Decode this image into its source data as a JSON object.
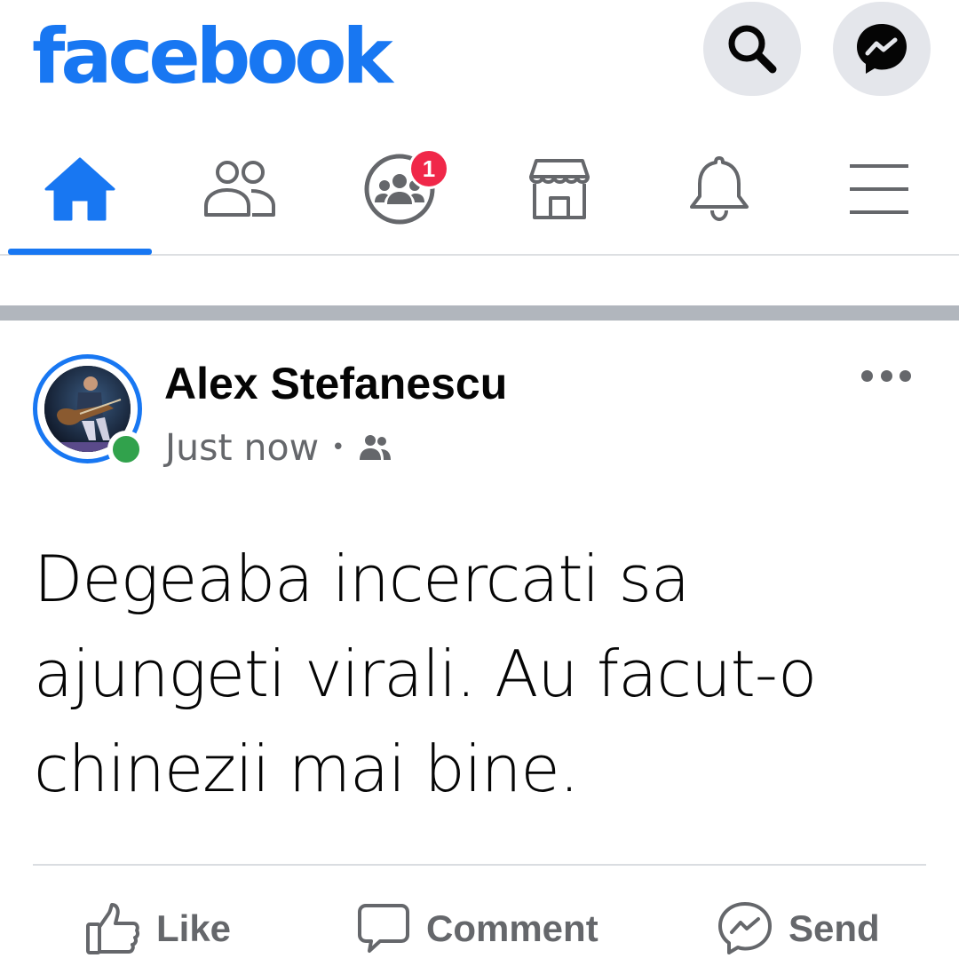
{
  "app": {
    "logo_text": "facebook",
    "brand_color": "#1877f2"
  },
  "header": {
    "search_icon": "search-icon",
    "messenger_icon": "messenger-icon"
  },
  "nav": {
    "tabs": [
      {
        "name": "home",
        "icon": "home-icon",
        "active": true
      },
      {
        "name": "friends",
        "icon": "friends-icon",
        "active": false
      },
      {
        "name": "groups",
        "icon": "groups-icon",
        "active": false,
        "badge": "1"
      },
      {
        "name": "marketplace",
        "icon": "marketplace-icon",
        "active": false
      },
      {
        "name": "notifications",
        "icon": "bell-icon",
        "active": false
      },
      {
        "name": "menu",
        "icon": "hamburger-icon",
        "active": false
      }
    ]
  },
  "post": {
    "author": "Alex Stefanescu",
    "timestamp": "Just now",
    "separator": "•",
    "audience_icon": "friends-audience-icon",
    "online": true,
    "text": "Degeaba incercati sa ajungeti virali. Au facut-o chinezii mai bine.",
    "actions": {
      "like": "Like",
      "comment": "Comment",
      "send": "Send"
    }
  },
  "colors": {
    "online": "#31a24c",
    "badge": "#f02849",
    "secondary_text": "#65676b"
  }
}
